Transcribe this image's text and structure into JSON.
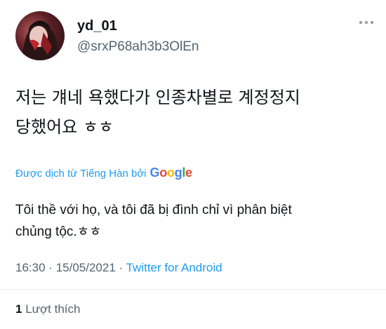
{
  "tweet": {
    "display_name": "yd_01",
    "handle": "@srxP68ah3b3OlEn",
    "text": "저는 걔네 욕했다가 인종차별로 계정정지\n당했어요 ㅎㅎ",
    "translated_by_label": "Được dịch từ Tiếng Hàn bởi",
    "translator_logo_text": [
      "G",
      "o",
      "o",
      "g",
      "l",
      "e"
    ],
    "translation": "Tôi thề với họ, và tôi đã bị đình chỉ vì phân biệt\nchủng tộc.ㅎㅎ",
    "time": "16:30",
    "separator": "·",
    "date": "15/05/2021",
    "source": "Twitter for Android",
    "like_count": "1",
    "like_label": "Lượt thích"
  },
  "icons": {
    "more": "more-dots-icon",
    "avatar": "avatar-image"
  },
  "colors": {
    "link": "#1d9bf0",
    "secondary_text": "#536471",
    "primary_text": "#0f1419"
  }
}
